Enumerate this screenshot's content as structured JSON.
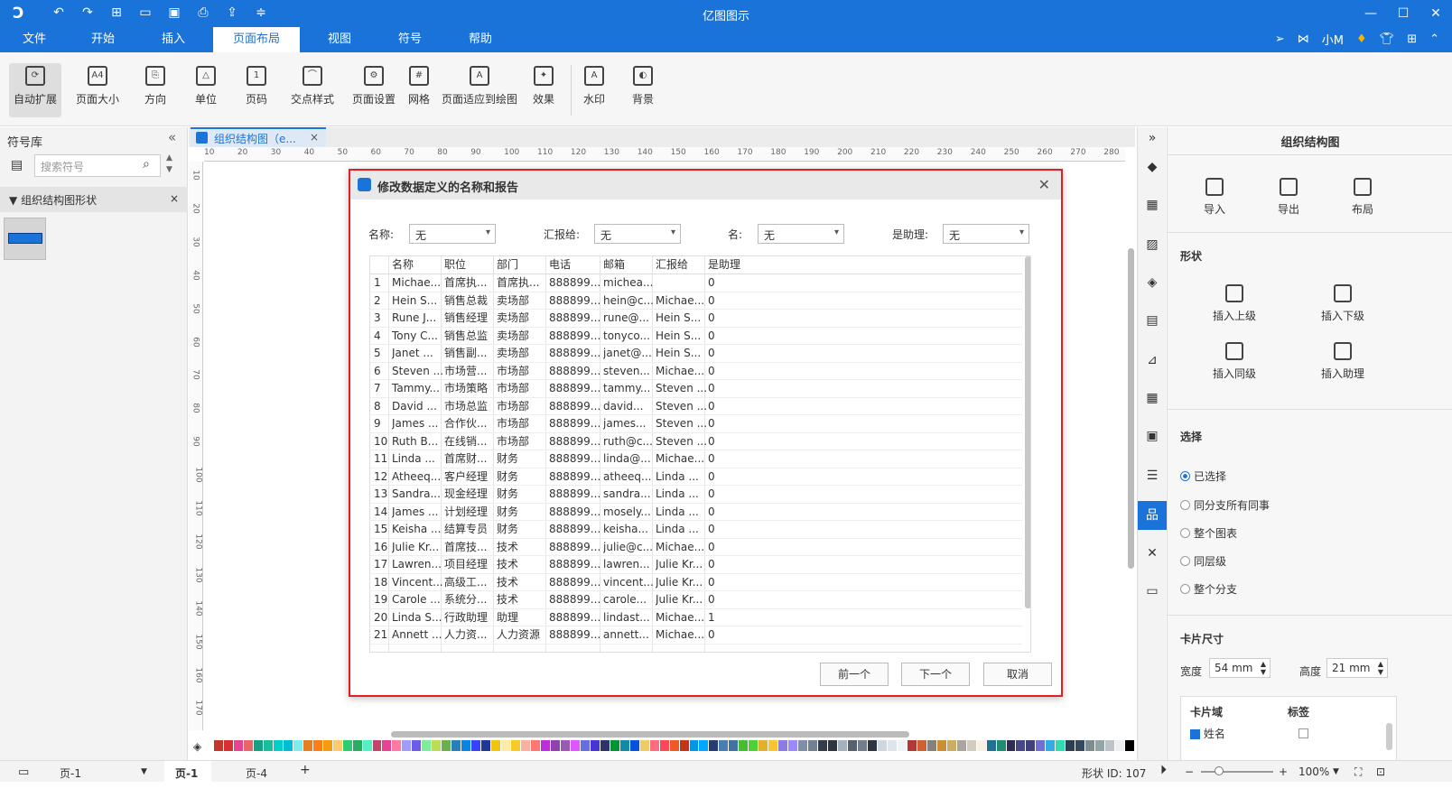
{
  "window": {
    "title": "亿图图示"
  },
  "menu": [
    "文件",
    "开始",
    "插入",
    "页面布局",
    "视图",
    "符号",
    "帮助"
  ],
  "menu_active_index": 3,
  "user": {
    "name": "小M"
  },
  "ribbon": [
    {
      "label": "自动扩展",
      "icon": "auto-extend-icon"
    },
    {
      "label": "页面大小",
      "icon": "page-size-icon"
    },
    {
      "label": "方向",
      "icon": "orientation-icon"
    },
    {
      "label": "单位",
      "icon": "unit-icon"
    },
    {
      "label": "页码",
      "icon": "page-number-icon"
    },
    {
      "label": "交点样式",
      "icon": "jump-style-icon"
    },
    {
      "label": "页面设置",
      "icon": "page-setup-icon"
    },
    {
      "label": "网格",
      "icon": "grid-icon"
    },
    {
      "label": "页面适应到绘图",
      "icon": "fit-page-icon"
    },
    {
      "label": "效果",
      "icon": "effect-icon"
    },
    {
      "label": "水印",
      "icon": "watermark-icon"
    },
    {
      "label": "背景",
      "icon": "background-icon"
    }
  ],
  "library": {
    "title": "符号库",
    "search_placeholder": "搜索符号",
    "section": "组织结构图形状"
  },
  "doc_tab": "组织结构图（e...",
  "ruler": {
    "h": [
      "10",
      "20",
      "30",
      "40",
      "50",
      "60",
      "70",
      "80",
      "90",
      "100",
      "110",
      "120",
      "130",
      "140",
      "150",
      "160",
      "170",
      "180",
      "190",
      "200",
      "210",
      "220",
      "230",
      "240",
      "250",
      "260",
      "270",
      "280"
    ],
    "v": [
      "10",
      "20",
      "30",
      "40",
      "50",
      "60",
      "70",
      "80",
      "90",
      "100",
      "110",
      "120",
      "130",
      "140",
      "150",
      "160",
      "170"
    ]
  },
  "dialog": {
    "title": "修改数据定义的名称和报告",
    "fields": [
      {
        "label": "名称:",
        "value": "无"
      },
      {
        "label": "汇报给:",
        "value": "无"
      },
      {
        "label": "名:",
        "value": "无"
      },
      {
        "label": "是助理:",
        "value": "无"
      }
    ],
    "columns": [
      "",
      "名称",
      "职位",
      "部门",
      "电话",
      "邮箱",
      "汇报给",
      "是助理"
    ],
    "rows": [
      [
        "1",
        "Michae...",
        "首席执...",
        "首席执...",
        "888899...",
        "michea...",
        "",
        "0"
      ],
      [
        "2",
        "Hein S...",
        "销售总裁",
        "卖场部",
        "888899...",
        "hein@c...",
        "Michae...",
        "0"
      ],
      [
        "3",
        "Rune J...",
        "销售经理",
        "卖场部",
        "888899...",
        "rune@...",
        "Hein S...",
        "0"
      ],
      [
        "4",
        "Tony C...",
        "销售总监",
        "卖场部",
        "888899...",
        "tonyco...",
        "Hein S...",
        "0"
      ],
      [
        "5",
        "Janet ...",
        "销售副...",
        "卖场部",
        "888899...",
        "janet@...",
        "Hein S...",
        "0"
      ],
      [
        "6",
        "Steven ...",
        "市场营...",
        "市场部",
        "888899...",
        "steven...",
        "Michae...",
        "0"
      ],
      [
        "7",
        "Tammy...",
        "市场策略",
        "市场部",
        "888899...",
        "tammy...",
        "Steven ...",
        "0"
      ],
      [
        "8",
        "David ...",
        "市场总监",
        "市场部",
        "888899...",
        "david...",
        "Steven ...",
        "0"
      ],
      [
        "9",
        "James ...",
        "合作伙...",
        "市场部",
        "888899...",
        "james...",
        "Steven ...",
        "0"
      ],
      [
        "10",
        "Ruth B...",
        "在线销...",
        "市场部",
        "888899...",
        "ruth@c...",
        "Steven ...",
        "0"
      ],
      [
        "11",
        "Linda ...",
        "首席财...",
        "财务",
        "888899...",
        "linda@...",
        "Michae...",
        "0"
      ],
      [
        "12",
        "Atheeq...",
        "客户经理",
        "财务",
        "888899...",
        "atheeq...",
        "Linda ...",
        "0"
      ],
      [
        "13",
        "Sandra...",
        "现金经理",
        "财务",
        "888899...",
        "sandra...",
        "Linda ...",
        "0"
      ],
      [
        "14",
        "James ...",
        "计划经理",
        "财务",
        "888899...",
        "mosely...",
        "Linda ...",
        "0"
      ],
      [
        "15",
        "Keisha ...",
        "结算专员",
        "财务",
        "888899...",
        "keisha...",
        "Linda ...",
        "0"
      ],
      [
        "16",
        "Julie Kr...",
        "首席技...",
        "技术",
        "888899...",
        "julie@c...",
        "Michae...",
        "0"
      ],
      [
        "17",
        "Lawren...",
        "项目经理",
        "技术",
        "888899...",
        "lawren...",
        "Julie Kr...",
        "0"
      ],
      [
        "18",
        "Vincent...",
        "高级工...",
        "技术",
        "888899...",
        "vincent...",
        "Julie Kr...",
        "0"
      ],
      [
        "19",
        "Carole ...",
        "系统分...",
        "技术",
        "888899...",
        "carole...",
        "Julie Kr...",
        "0"
      ],
      [
        "20",
        "Linda S...",
        "行政助理",
        "助理",
        "888899...",
        "lindast...",
        "Michae...",
        "1"
      ],
      [
        "21",
        "Annett ...",
        "人力资...",
        "人力资源",
        "888899...",
        "annett...",
        "Michae...",
        "0"
      ]
    ],
    "buttons": {
      "prev": "前一个",
      "next": "下一个",
      "cancel": "取消"
    }
  },
  "right_panel": {
    "title": "组织结构图",
    "actions": [
      "导入",
      "导出",
      "布局"
    ],
    "shape_title": "形状",
    "shape_actions": [
      "插入上级",
      "插入下级",
      "插入同级",
      "插入助理"
    ],
    "select_title": "选择",
    "select_options": [
      "已选择",
      "同分支所有同事",
      "整个图表",
      "同层级",
      "整个分支"
    ],
    "select_checked": 0,
    "card_title": "卡片尺寸",
    "width_label": "宽度",
    "width_value": "54 mm",
    "height_label": "高度",
    "height_value": "21 mm",
    "card_fields_header": "卡片域",
    "card_labels_header": "标签",
    "card_field_1": "姓名"
  },
  "status": {
    "page_selector": "页-1",
    "tab_1": "页-1",
    "tab_2": "页-4",
    "shape_id": "形状 ID: 107",
    "zoom": "100%"
  },
  "palette": [
    "#c0392b",
    "#d63031",
    "#e84393",
    "#e66767",
    "#16a085",
    "#1abc9c",
    "#00cec9",
    "#00bcd4",
    "#81ecec",
    "#e67e22",
    "#fd7e14",
    "#f39c12",
    "#fdcb6e",
    "#2ecc71",
    "#27ae60",
    "#55efc4",
    "#c44569",
    "#e84393",
    "#fd79a8",
    "#a29bfe",
    "#6c5ce7",
    "#7bed9f",
    "#badc58",
    "#6ab04c",
    "#2980b9",
    "#0984e3",
    "#3742fa",
    "#1e3799",
    "#f1c40f",
    "#ffeaa7",
    "#f9ca24",
    "#fab1a0",
    "#ff7675",
    "#be2edd",
    "#8e44ad",
    "#9b59b6",
    "#e056fd",
    "#686de0",
    "#4834d4",
    "#30336b",
    "#009432",
    "#1289a7",
    "#0652dd",
    "#eccc68",
    "#ff6b81",
    "#ff4757",
    "#ee5a24",
    "#c23616",
    "#0097e6",
    "#00a8ff",
    "#273c75",
    "#487eb0",
    "#40739e",
    "#44bd32",
    "#4cd137",
    "#e1b12c",
    "#fbc531",
    "#8c7ae6",
    "#9c88ff",
    "#7f8fa6",
    "#718093",
    "#353b48",
    "#2f3640",
    "#a4b0be",
    "#57606f",
    "#747d8c",
    "#2f3542",
    "#ced6e0",
    "#dfe4ea",
    "#f1f2f6",
    "#b33939",
    "#cd6133",
    "#84817a",
    "#cc8e35",
    "#ccae62",
    "#aaa69d",
    "#d1ccc0",
    "#f7f1e3",
    "#227093",
    "#218c74",
    "#2c2c54",
    "#474787",
    "#40407a",
    "#706fd3",
    "#34ace0",
    "#33d9b2",
    "#2c3e50",
    "#34495e",
    "#7f8c8d",
    "#95a5a6",
    "#bdc3c7",
    "#ecf0f1",
    "#000000"
  ]
}
